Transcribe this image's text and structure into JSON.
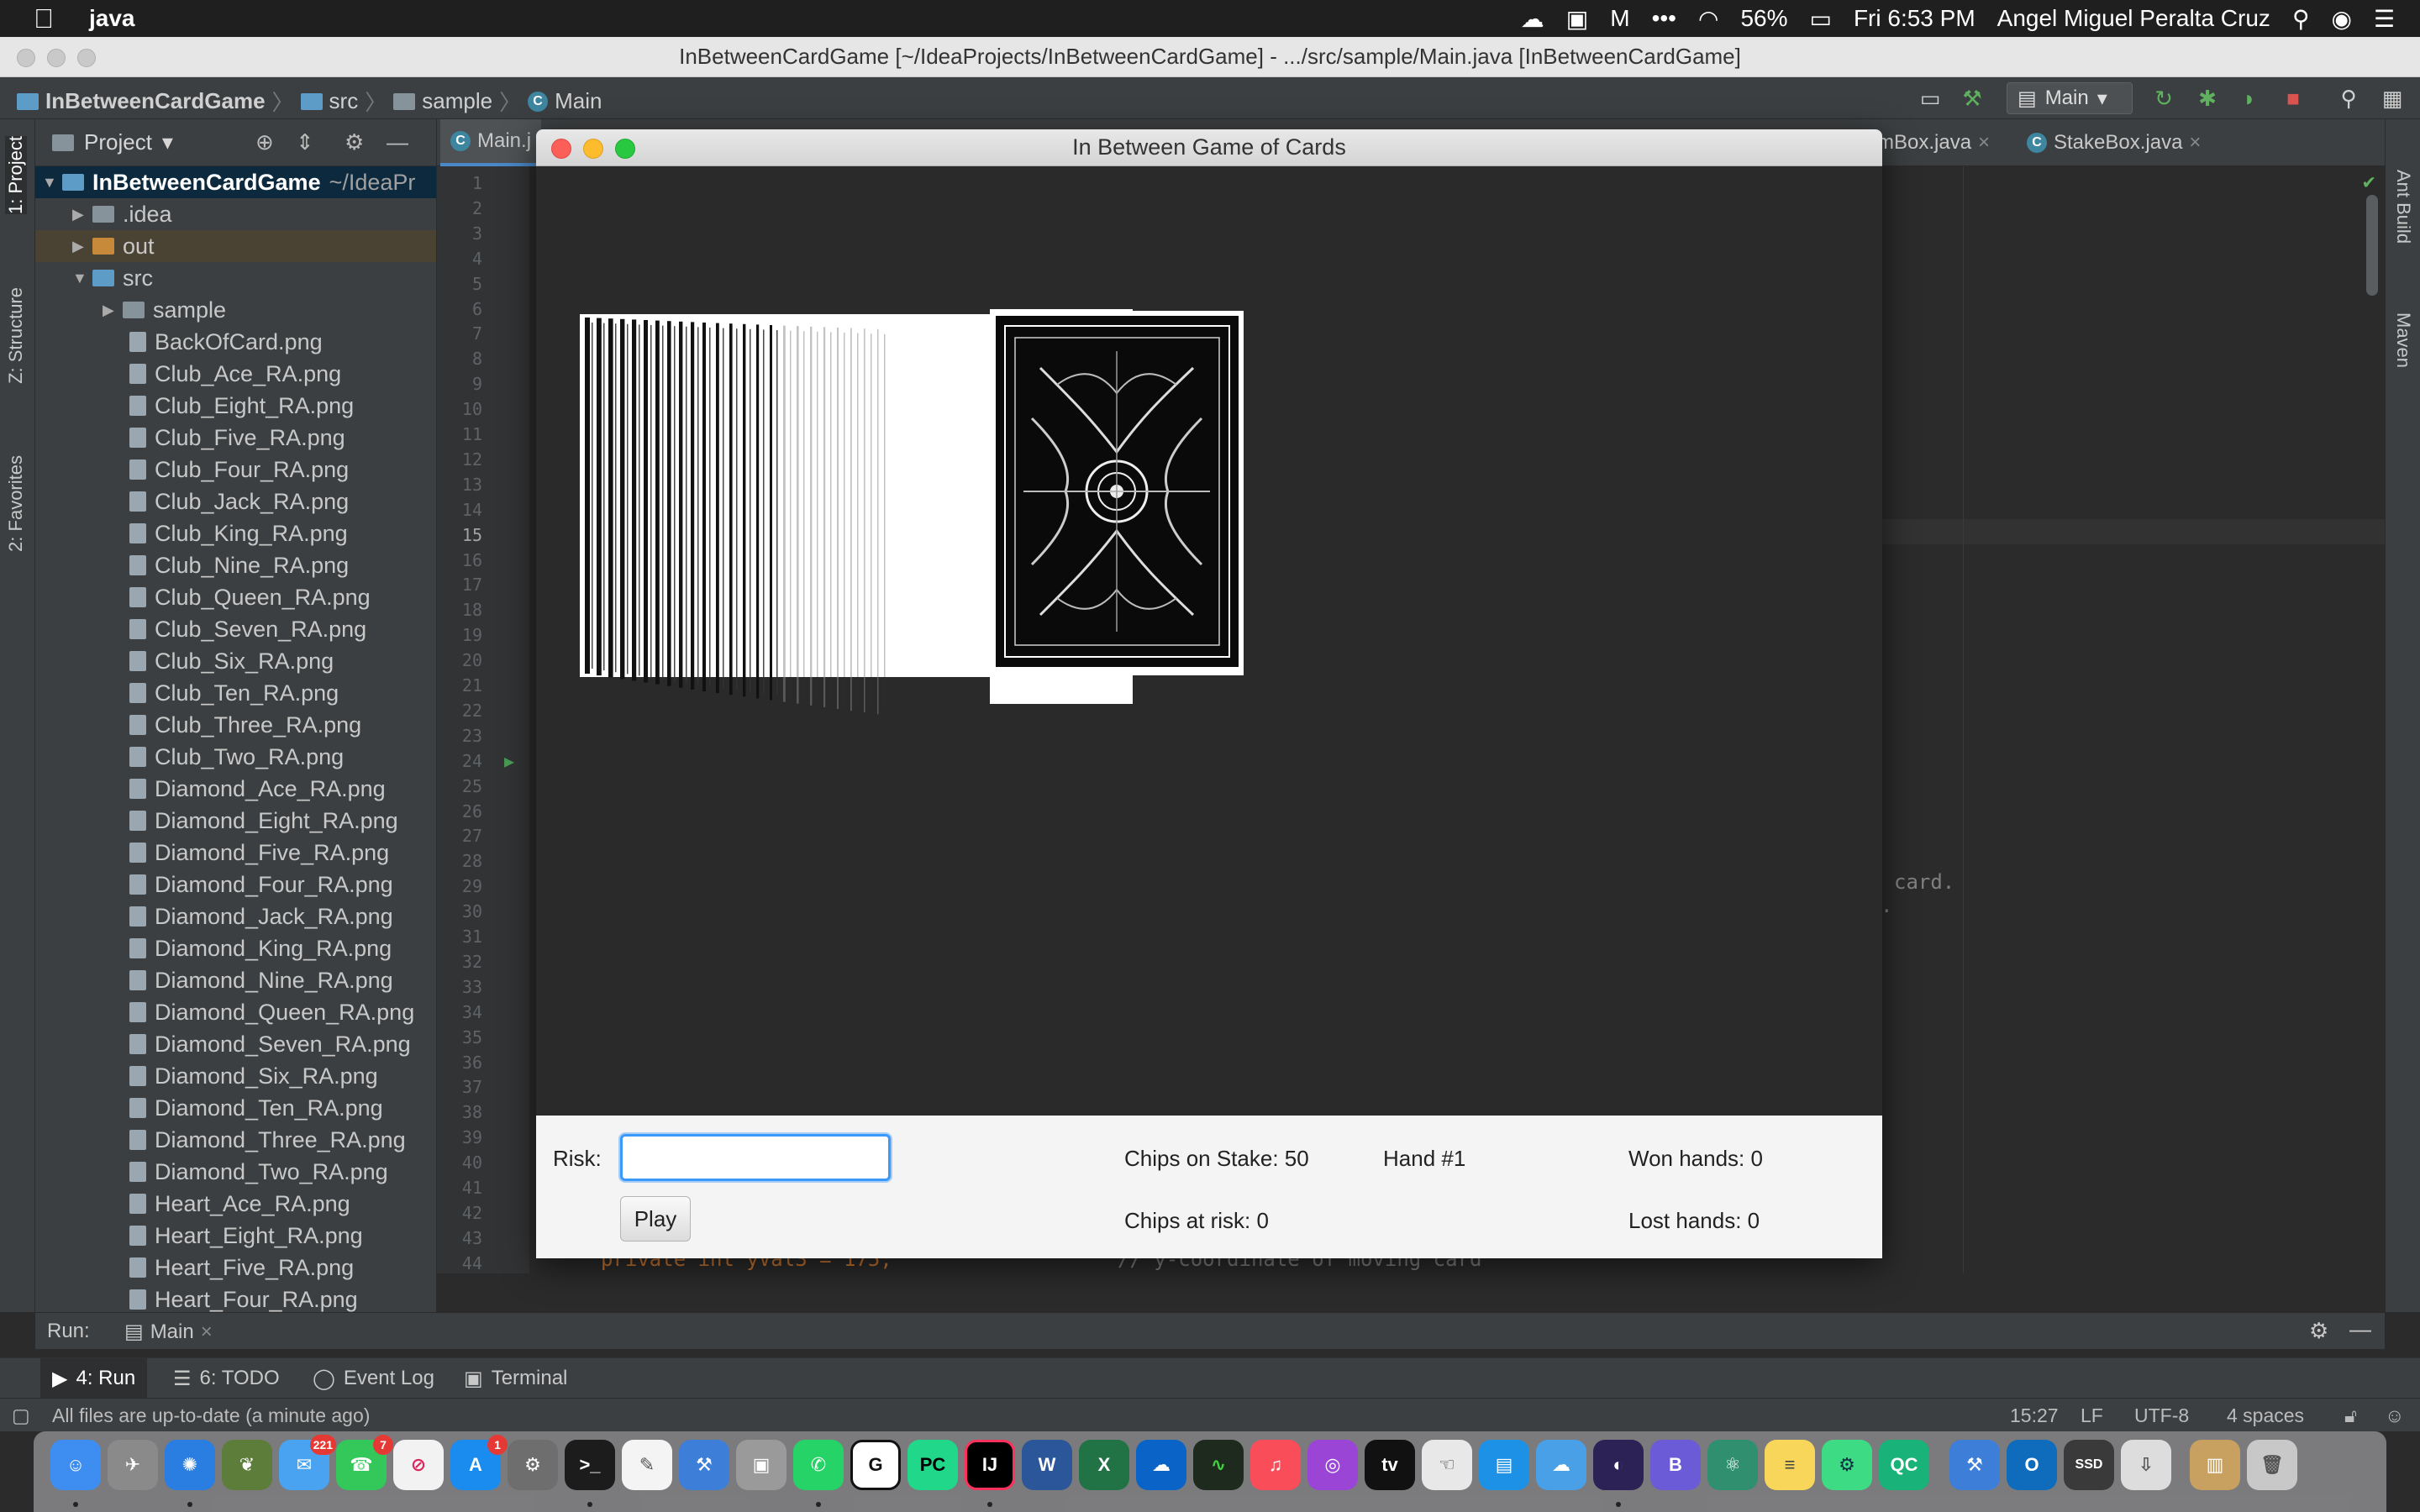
{
  "menubar": {
    "app_name": "java",
    "battery": "56%",
    "clock": "Fri 6:53 PM",
    "user": "Angel Miguel Peralta Cruz"
  },
  "ide": {
    "window_title": "InBetweenCardGame [~/IdeaProjects/InBetweenCardGame] - .../src/sample/Main.java [InBetweenCardGame]",
    "breadcrumbs": [
      "InBetweenCardGame",
      "src",
      "sample",
      "Main"
    ],
    "run_config": "Main",
    "left_tabs": [
      "1: Project",
      "Z: Structure",
      "2: Favorites"
    ],
    "right_tabs": [
      "Ant Build",
      "Maven"
    ],
    "project_header": "Project",
    "tree": {
      "root_name": "InBetweenCardGame",
      "root_path": "~/IdeaPr",
      "folders": [
        ".idea",
        "out",
        "src",
        "sample"
      ],
      "files": [
        "BackOfCard.png",
        "Club_Ace_RA.png",
        "Club_Eight_RA.png",
        "Club_Five_RA.png",
        "Club_Four_RA.png",
        "Club_Jack_RA.png",
        "Club_King_RA.png",
        "Club_Nine_RA.png",
        "Club_Queen_RA.png",
        "Club_Seven_RA.png",
        "Club_Six_RA.png",
        "Club_Ten_RA.png",
        "Club_Three_RA.png",
        "Club_Two_RA.png",
        "Diamond_Ace_RA.png",
        "Diamond_Eight_RA.png",
        "Diamond_Five_RA.png",
        "Diamond_Four_RA.png",
        "Diamond_Jack_RA.png",
        "Diamond_King_RA.png",
        "Diamond_Nine_RA.png",
        "Diamond_Queen_RA.png",
        "Diamond_Seven_RA.png",
        "Diamond_Six_RA.png",
        "Diamond_Ten_RA.png",
        "Diamond_Three_RA.png",
        "Diamond_Two_RA.png",
        "Heart_Ace_RA.png",
        "Heart_Eight_RA.png",
        "Heart_Five_RA.png",
        "Heart_Four_RA.png"
      ]
    },
    "editor_tabs": [
      "Main.j",
      "mBox.java",
      "StakeBox.java"
    ],
    "line_numbers": [
      "1",
      "2",
      "3",
      "4",
      "5",
      "6",
      "7",
      "8",
      "9",
      "10",
      "11",
      "12",
      "13",
      "14",
      "15",
      "16",
      "17",
      "18",
      "19",
      "20",
      "21",
      "22",
      "23",
      "24",
      "25",
      "26",
      "27",
      "28",
      "29",
      "30",
      "31",
      "32",
      "33",
      "34",
      "35",
      "36",
      "37",
      "38",
      "39",
      "40",
      "41",
      "42",
      "43",
      "44"
    ],
    "current_line": "15",
    "code_fragments": {
      "right_1": "card.",
      "right_2": ".",
      "bottom_code": "private int yVal3 = 175;",
      "bottom_comment": "// y-coordinate of moving card"
    },
    "run": {
      "label": "Run:",
      "tab": "Main"
    },
    "tool_tabs": [
      "4: Run",
      "6: TODO",
      "Event Log",
      "Terminal"
    ],
    "status": {
      "message": "All files are up-to-date (a minute ago)",
      "position": "15:27",
      "line_sep": "LF",
      "encoding": "UTF-8",
      "indent": "4 spaces"
    }
  },
  "game": {
    "title": "In Between Game of Cards",
    "risk_label": "Risk:",
    "risk_value": "",
    "play_label": "Play",
    "chips_on_stake": "Chips on Stake: 50",
    "chips_at_risk": "Chips at risk: 0",
    "hand": "Hand #1",
    "won_hands": "Won hands: 0",
    "lost_hands": "Lost hands: 0"
  },
  "dock": {
    "badges": {
      "messages": "221",
      "facetime": "7",
      "appstore": "1"
    },
    "labels": {
      "pycharm": "PC",
      "intellij": "IJ",
      "word": "W",
      "excel": "X",
      "qc": "QC",
      "tv": "tv",
      "ssd": "SSD"
    }
  },
  "colors": {
    "accent": "#4a88c7",
    "focus_ring": "#3b99fc",
    "ide_bg": "#2b2b2b",
    "panel_bg": "#3c3f41"
  }
}
